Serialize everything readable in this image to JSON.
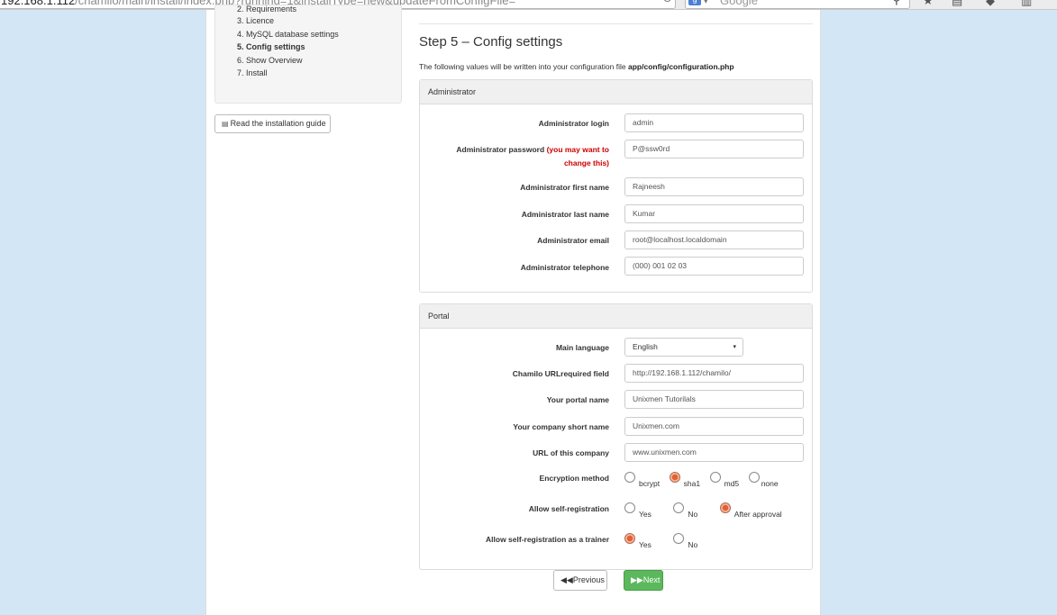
{
  "browser": {
    "url_host": "192.168.1.112",
    "url_path": "/chamilo/main/install/index.php?running=1&installType=new&updateFromConfigFile=",
    "search_engine": "Google",
    "search_placeholder": "Google"
  },
  "sidebar": {
    "steps": [
      {
        "label": "2. Requirements",
        "active": false
      },
      {
        "label": "3. Licence",
        "active": false
      },
      {
        "label": "4. MySQL database settings",
        "active": false
      },
      {
        "label": "5. Config settings",
        "active": true
      },
      {
        "label": "6. Show Overview",
        "active": false
      },
      {
        "label": "7. Install",
        "active": false
      }
    ],
    "guide_button": "Read the installation guide"
  },
  "main": {
    "title": "Step 5 – Config settings",
    "intro_text": "The following values will be written into your configuration file",
    "intro_file": "app/config/configuration.php",
    "administrator": {
      "heading": "Administrator",
      "login_label": "Administrator login",
      "login_value": "admin",
      "password_label": "Administrator password",
      "password_hint": "(you may want to change this)",
      "password_value": "P@ssw0rd",
      "firstname_label": "Administrator first name",
      "firstname_value": "Rajneesh",
      "lastname_label": "Administrator last name",
      "lastname_value": "Kumar",
      "email_label": "Administrator email",
      "email_value": "root@localhost.localdomain",
      "phone_label": "Administrator telephone",
      "phone_value": "(000) 001 02 03"
    },
    "portal": {
      "heading": "Portal",
      "language_label": "Main language",
      "language_value": "English",
      "url_label": "Chamilo URLrequired field",
      "url_value": "http://192.168.1.112/chamilo/",
      "portal_name_label": "Your portal name",
      "portal_name_value": "Unixmen Tutorilals",
      "company_label": "Your company short name",
      "company_value": "Unixmen.com",
      "company_url_label": "URL of this company",
      "company_url_value": "www.unixmen.com",
      "encryption_label": "Encryption method",
      "encryption_options": [
        "bcrypt",
        "sha1",
        "md5",
        "none"
      ],
      "encryption_selected": "sha1",
      "selfreg_label": "Allow self-registration",
      "selfreg_options": [
        "Yes",
        "No",
        "After approval"
      ],
      "selfreg_selected": "After approval",
      "trainer_label": "Allow self-registration as a trainer",
      "trainer_options": [
        "Yes",
        "No"
      ],
      "trainer_selected": "Yes"
    },
    "buttons": {
      "previous": "Previous",
      "next": "Next"
    }
  },
  "colors": {
    "background": "#d3e6f5",
    "warning": "#cc0000",
    "next_button": "#5cb85c",
    "radio_selected": "#e65f2f"
  }
}
